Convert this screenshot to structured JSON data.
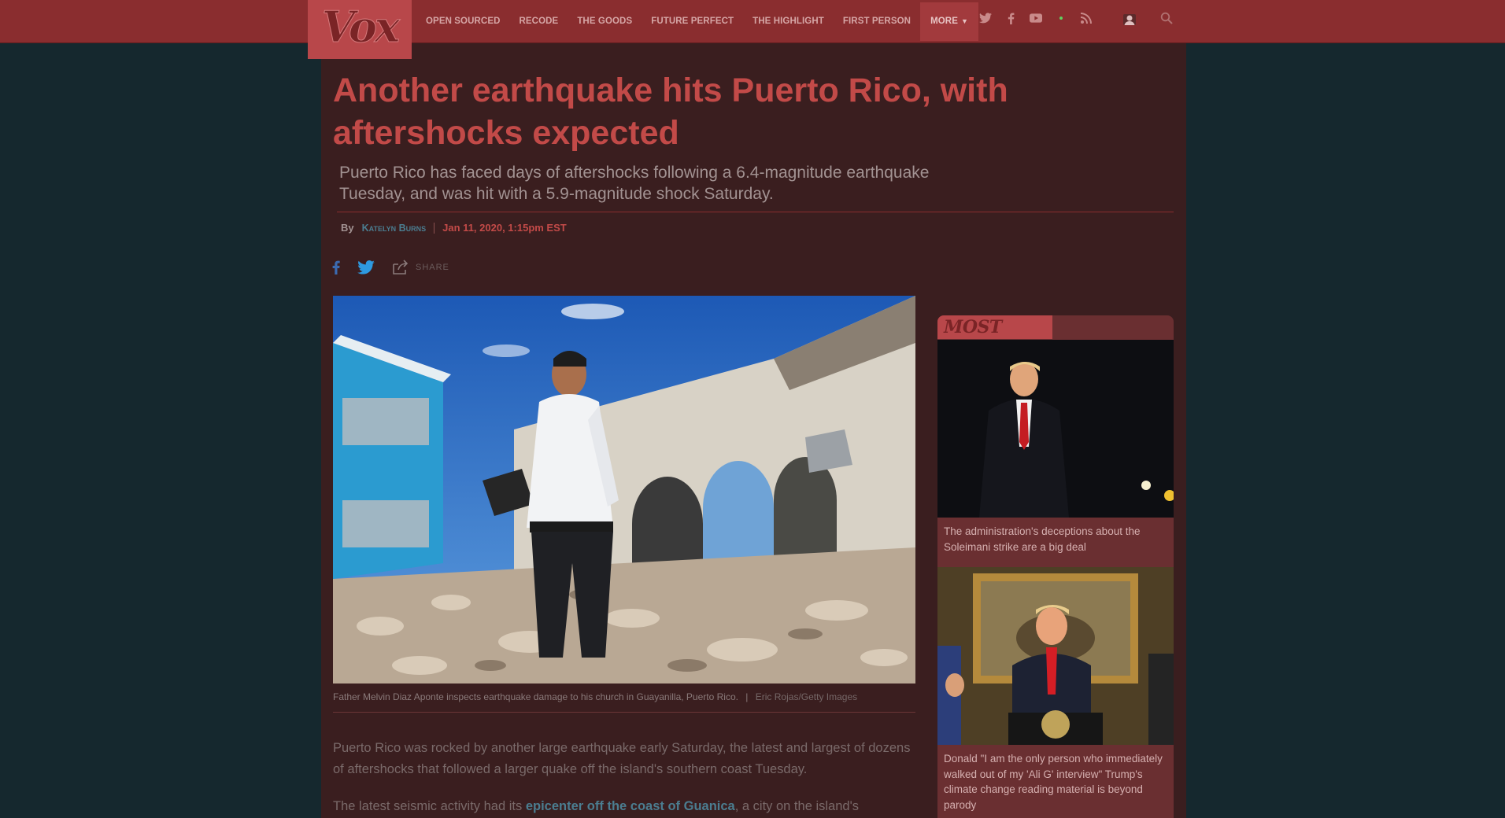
{
  "site": {
    "logo": "Vox"
  },
  "nav": {
    "items": [
      "OPEN SOURCED",
      "RECODE",
      "THE GOODS",
      "FUTURE PERFECT",
      "THE HIGHLIGHT",
      "FIRST PERSON"
    ],
    "more": "MORE"
  },
  "social_icons": [
    "twitter-icon",
    "facebook-icon",
    "youtube-icon",
    "dot-icon",
    "rss-icon"
  ],
  "article": {
    "headline": "Another earthquake hits Puerto Rico, with aftershocks expected",
    "dek": "Puerto Rico has faced days of aftershocks following a 6.4-magnitude earthquake Tuesday, and was hit with a 5.9-magnitude shock Saturday.",
    "by": "By",
    "author": "Katelyn Burns",
    "date": "Jan 11, 2020, 1:15pm EST",
    "share_label": "SHARE",
    "caption": "Father Melvin Diaz Aponte inspects earthquake damage to his church in Guayanilla, Puerto Rico.",
    "caption_sep": "|",
    "credit": "Eric Rojas/Getty Images",
    "p1": "Puerto Rico was rocked by another large earthquake early Saturday, the latest and largest of dozens of aftershocks that followed a larger quake off the island's southern coast Tuesday.",
    "p2_before": "The latest seismic activity had its ",
    "p2_link": "epicenter off the coast of Guanica",
    "p2_after": ", a city on the island's"
  },
  "most_read": {
    "title": "MOST READ",
    "items": [
      {
        "caption": "The administration's deceptions about the Soleimani strike are a big deal"
      },
      {
        "caption": "Donald \"I am the only person who immediately walked out of my 'Ali G' interview\" Trump's climate change reading material is beyond parody"
      }
    ]
  },
  "colors": {
    "bar": "#8a2d2f",
    "accent": "#c24a48",
    "link": "#4b7d90",
    "page_bg": "#15282e"
  }
}
